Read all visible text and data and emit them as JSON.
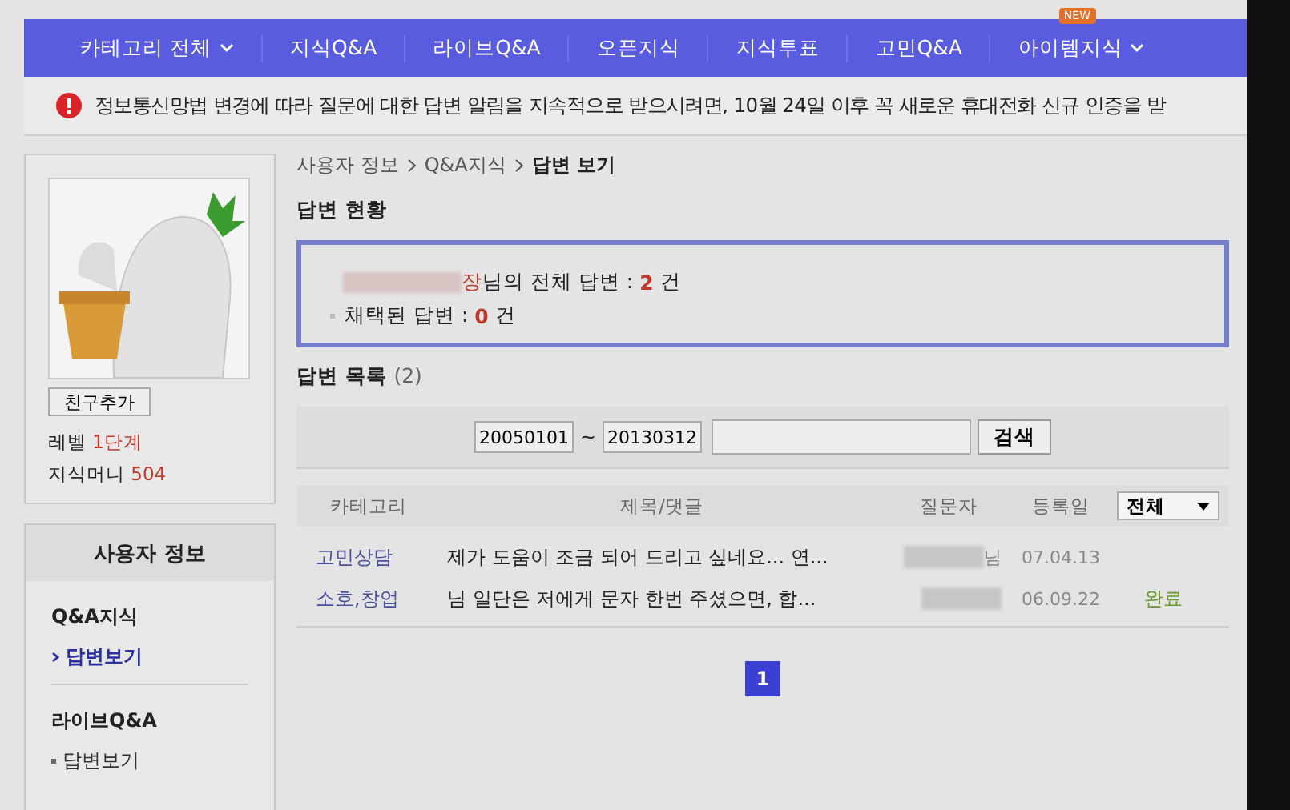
{
  "nav": {
    "items": [
      {
        "label": "카테고리 전체",
        "dropdown": true
      },
      {
        "label": "지식Q&A",
        "dropdown": false
      },
      {
        "label": "라이브Q&A",
        "dropdown": false
      },
      {
        "label": "오픈지식",
        "dropdown": false
      },
      {
        "label": "지식투표",
        "dropdown": false
      },
      {
        "label": "고민Q&A",
        "dropdown": false
      },
      {
        "label": "아이템지식",
        "dropdown": true,
        "badge": "NEW"
      }
    ]
  },
  "notice": "정보통신망법 변경에 따라 질문에 대한 답변 알림을 지속적으로 받으시려면, 10월 24일 이후 꼭 새로운 휴대전화 신규 인증을 받",
  "profile": {
    "add_friend": "친구추가",
    "stats": [
      {
        "label": "레벨",
        "value": "1단계"
      },
      {
        "label": "지식머니",
        "value": "504"
      }
    ]
  },
  "user_menu": {
    "title": "사용자 정보",
    "sections": [
      {
        "title": "Q&A지식",
        "items": [
          {
            "label": "답변보기",
            "selected": true
          }
        ]
      },
      {
        "title": "라이브Q&A",
        "items": [
          {
            "label": "답변보기",
            "selected": false
          }
        ]
      }
    ]
  },
  "breadcrumb": [
    {
      "label": "사용자 정보",
      "current": false
    },
    {
      "label": "Q&A지식",
      "current": false
    },
    {
      "label": "답변 보기",
      "current": true
    }
  ],
  "summary": {
    "title": "답변 현황",
    "name_suffix": "장",
    "total_label": "님의 전체 답변 : ",
    "total": "2",
    "total_unit": "건",
    "chosen_label": "채택된 답변 : ",
    "chosen": "0",
    "chosen_unit": "건"
  },
  "list": {
    "title": "답변 목록",
    "count": "(2)",
    "date_from": "20050101",
    "date_sep": "~",
    "date_to": "20130312",
    "search_button": "검색",
    "columns": [
      "카테고리",
      "제목/댓글",
      "질문자",
      "등록일"
    ],
    "filter": "전체",
    "rows": [
      {
        "category": "고민상담",
        "title": "제가 도움이 조금 되어 드리고 싶네요... 연...",
        "asker": "님",
        "date": "07.04.13"
      },
      {
        "category": "소호,창업",
        "title": "님 일단은 저에게 문자 한번 주셨으면, 합...",
        "date": "06.09.22",
        "status": "완료"
      }
    ],
    "pages": [
      {
        "label": "1",
        "selected": true
      }
    ]
  }
}
